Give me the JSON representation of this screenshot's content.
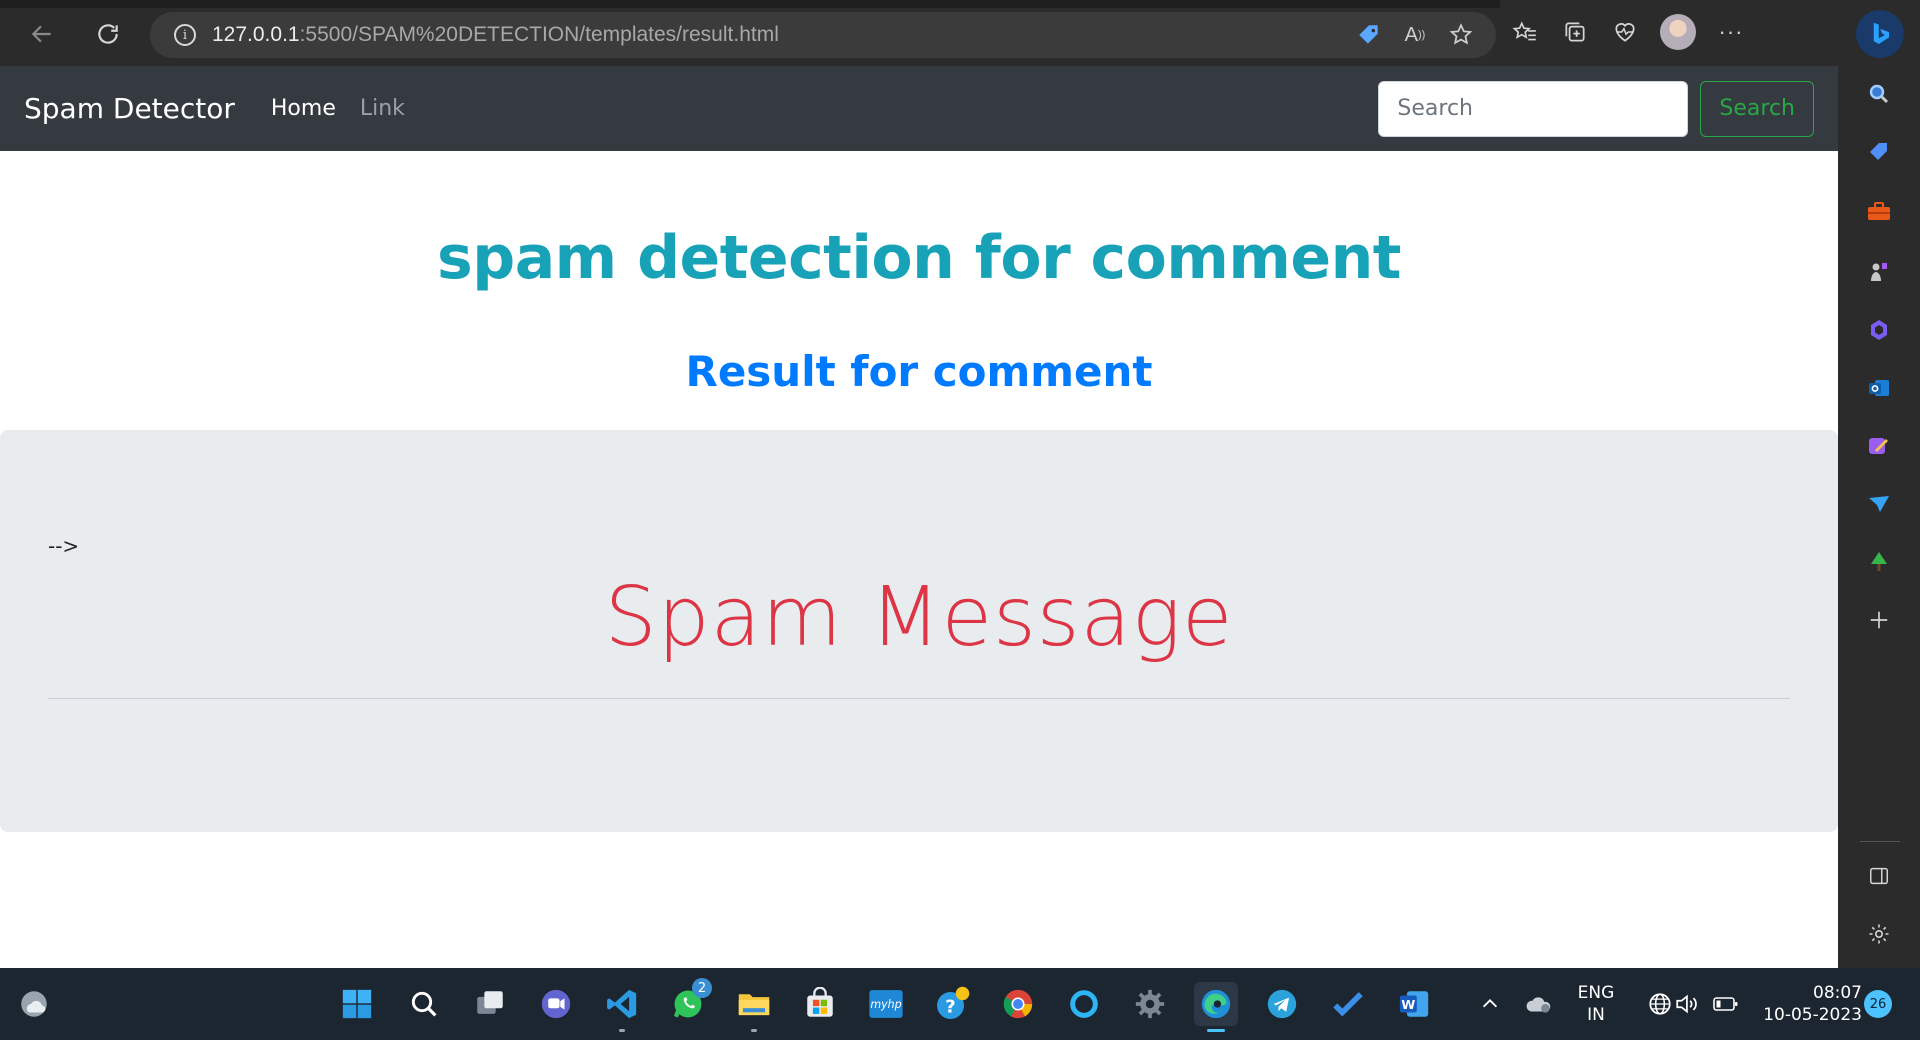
{
  "browser": {
    "url_host": "127.0.0.1",
    "url_rest": ":5500/SPAM%20DETECTION/templates/result.html"
  },
  "page": {
    "brand": "Spam Detector",
    "nav_links": [
      "Home",
      "Link"
    ],
    "search_placeholder": "Search",
    "search_button": "Search",
    "heading": "spam detection for comment",
    "subheading": "Result for comment",
    "stray_text": "-->",
    "result": "Spam Message",
    "result_color": "#dc3545",
    "heading_color": "#17a2b8",
    "subheading_color": "#007bff"
  },
  "taskbar": {
    "language_line1": "ENG",
    "language_line2": "IN",
    "time": "08:07",
    "date": "10-05-2023",
    "notification_count": "26",
    "whatsapp_badge": "2"
  }
}
